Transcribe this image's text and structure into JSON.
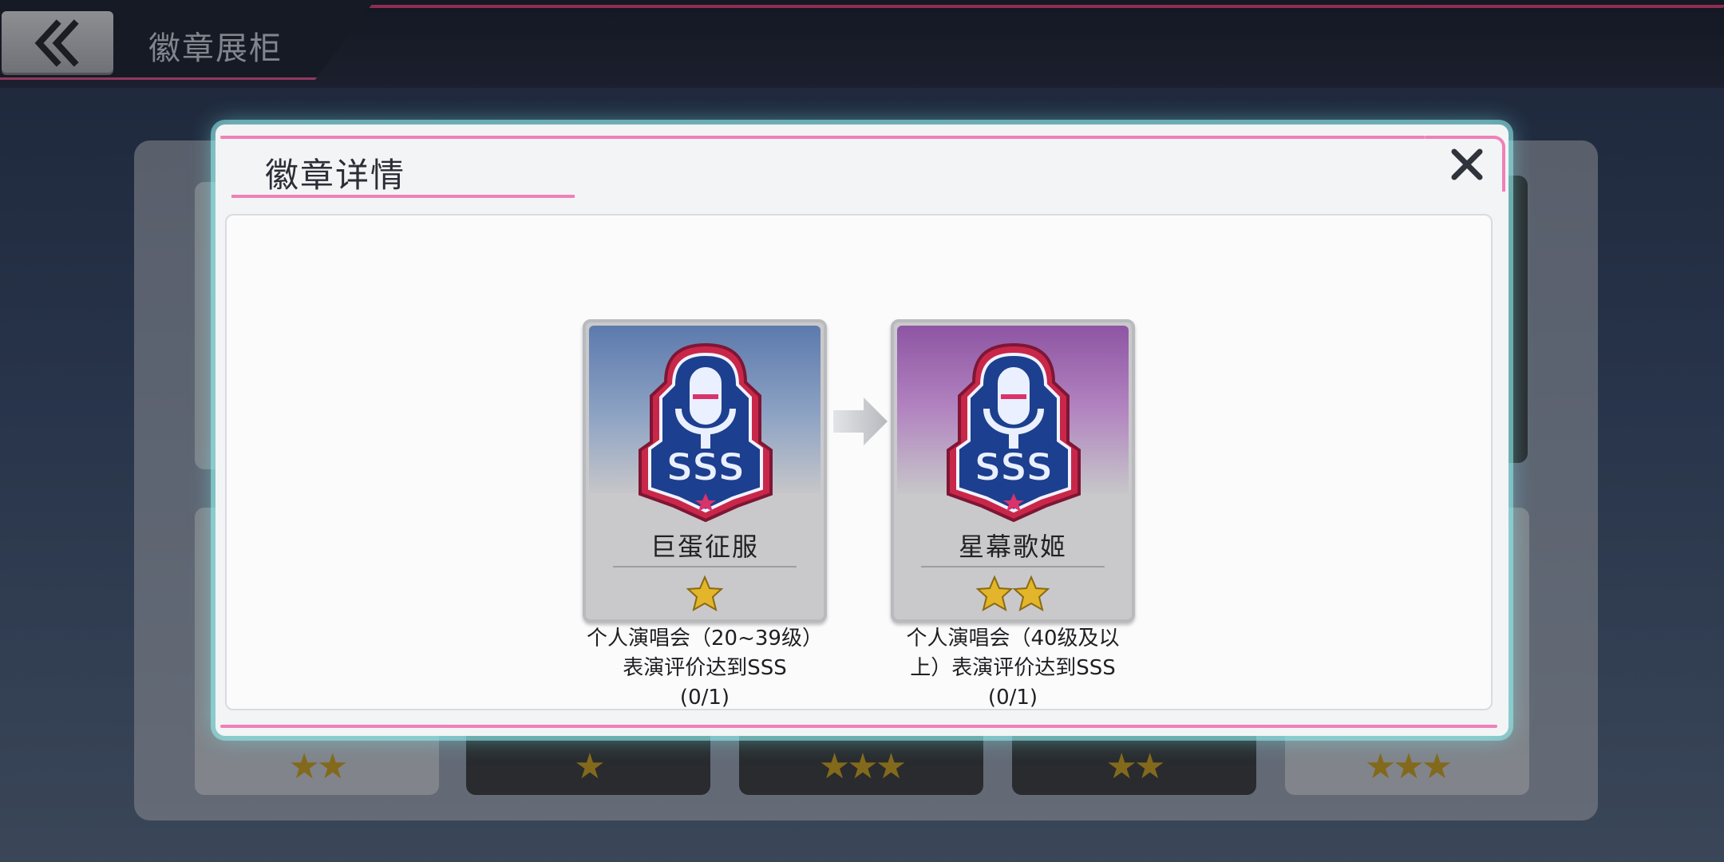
{
  "header": {
    "title": "徽章展柜"
  },
  "background_cards": [
    {
      "label": "",
      "stars": 0
    },
    {
      "label": "",
      "stars": 0
    },
    {
      "label": "",
      "stars": 0
    },
    {
      "label": "",
      "stars": 0
    },
    {
      "label": "",
      "stars": 0
    },
    {
      "label": "",
      "stars": 2
    },
    {
      "label": "",
      "stars": 1
    },
    {
      "label": "",
      "stars": 3
    },
    {
      "label": "",
      "stars": 2
    },
    {
      "label": "",
      "stars": 3
    }
  ],
  "dialog": {
    "title": "徽章详情",
    "badges": [
      {
        "name": "巨蛋征服",
        "stars": 1,
        "theme": "blue",
        "desc_line1": "个人演唱会（20~39级）",
        "desc_line2": "表演评价达到SSS",
        "progress": "(0/1)"
      },
      {
        "name": "星幕歌姬",
        "stars": 2,
        "theme": "purple",
        "desc_line1": "个人演唱会（40级及以",
        "desc_line2": "上）表演评价达到SSS",
        "progress": "(0/1)"
      }
    ]
  },
  "icons": {
    "back": "double-chevron-left-icon",
    "close": "close-icon",
    "arrow": "arrow-right-icon",
    "star": "star-icon",
    "emblem": "microphone-sss-emblem"
  },
  "colors": {
    "accent_pink": "#f080b8",
    "star_gold": "#e3b52a",
    "dialog_glow": "#78f0f0"
  }
}
